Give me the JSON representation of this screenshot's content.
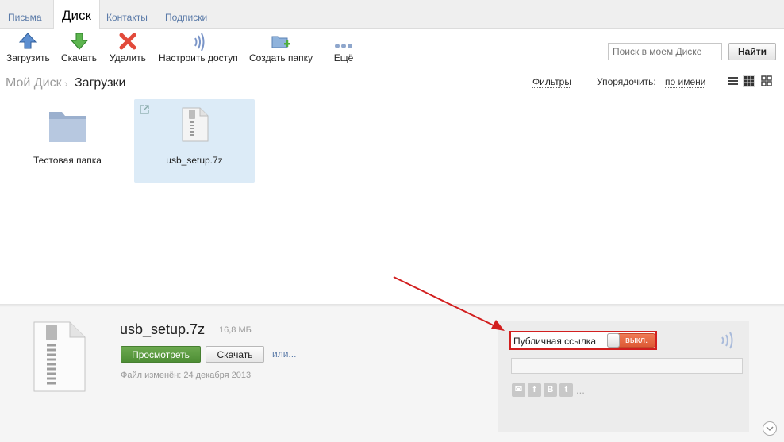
{
  "tabs": [
    {
      "label": "Письма"
    },
    {
      "label": "Диск"
    },
    {
      "label": "Контакты"
    },
    {
      "label": "Подписки"
    }
  ],
  "toolbar": {
    "upload": "Загрузить",
    "download": "Скачать",
    "delete": "Удалить",
    "access": "Настроить доступ",
    "new_folder": "Создать папку",
    "more": "Ещё"
  },
  "search": {
    "placeholder": "Поиск в моем Диске",
    "button": "Найти"
  },
  "breadcrumb": {
    "root": "Мой Диск",
    "separator": "›",
    "current": "Загрузки"
  },
  "controls": {
    "filters": "Фильтры",
    "sort_label": "Упорядочить:",
    "sort_value": "по имени"
  },
  "files": [
    {
      "name": "Тестовая папка",
      "type": "folder",
      "selected": false
    },
    {
      "name": "usb_setup.7z",
      "type": "archive",
      "selected": true
    }
  ],
  "details": {
    "name": "usb_setup.7z",
    "size": "16,8 МБ",
    "view_button": "Просмотреть",
    "download_button": "Скачать",
    "more_link": "или...",
    "modified": "Файл изменён: 24 декабря 2013"
  },
  "share": {
    "public_link_label": "Публичная ссылка",
    "toggle_state": "выкл.",
    "social": [
      "mail-icon",
      "facebook-icon",
      "vk-icon",
      "twitter-icon"
    ],
    "social_glyphs": [
      "✉",
      "f",
      "B",
      "t"
    ],
    "more": "..."
  },
  "colors": {
    "accent_link": "#5a7aa8",
    "toggle_off": "#e0603b",
    "highlight": "#d21f1f",
    "selected_bg": "#dcebf7"
  }
}
